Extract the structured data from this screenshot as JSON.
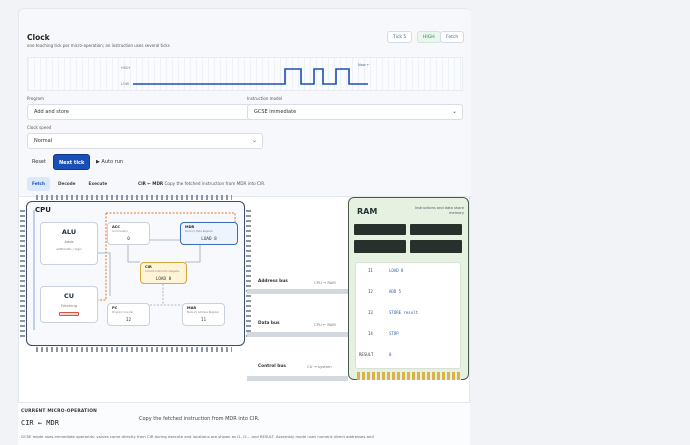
{
  "clock": {
    "title": "Clock",
    "subtitle": "one teaching tick per micro-operation; an instruction uses several ticks",
    "tick_label": "Tick 5",
    "level_label": "HIGH",
    "phase_label": "Fetch",
    "wave_high": "HIGH",
    "wave_low": "LOW",
    "wave_now": "Now ←"
  },
  "controls": {
    "program_label": "Program",
    "program_value": "Add and store",
    "model_label": "Instruction model",
    "model_value": "GCSE immediate",
    "speed_label": "Clock speed",
    "speed_value": "Normal",
    "reset": "Reset",
    "next_tick": "Next tick",
    "auto_run": "▶  Auto run"
  },
  "steps": {
    "items": [
      "Fetch",
      "Decode",
      "Execute"
    ],
    "active": "Fetch",
    "current_op": "CIR ← MDR",
    "current_desc": "Copy the fetched instruction from MDR into CIR."
  },
  "cpu": {
    "label": "CPU",
    "alu": {
      "title": "ALU",
      "sub": "Adds",
      "sub2": "arithmetic / logic"
    },
    "cu": {
      "title": "CU",
      "sub": "Fetching"
    },
    "acc": {
      "title": "ACC",
      "sub": "Accumulator",
      "value": "0"
    },
    "mdr": {
      "title": "MDR",
      "sub": "Memory Data Register",
      "value": "LOAD 8"
    },
    "cir": {
      "title": "CIR",
      "sub": "Current Instruction Register",
      "value": "LOAD 8"
    },
    "pc": {
      "title": "PC",
      "sub": "Program Counter",
      "value": "I2"
    },
    "mar": {
      "title": "MAR",
      "sub": "Memory Address Register",
      "value": "I1"
    }
  },
  "buses": {
    "address": "Address bus",
    "address_dir": "CPU → RAM",
    "data": "Data bus",
    "data_dir": "CPU ← RAM",
    "control": "Control bus",
    "control_dir": "CU → system"
  },
  "ram": {
    "title": "RAM",
    "subtitle": "Instructions and data share memory",
    "rows": [
      {
        "addr": "I1",
        "value": "LOAD 8"
      },
      {
        "addr": "I2",
        "value": "ADD 5"
      },
      {
        "addr": "I3",
        "value": "STORE result"
      },
      {
        "addr": "I4",
        "value": "STOP"
      },
      {
        "addr": "RESULT",
        "value": "0"
      }
    ]
  },
  "current": {
    "label": "CURRENT MICRO-OPERATION",
    "op": "CIR ← MDR",
    "desc": "Copy the fetched instruction from MDR into CIR.",
    "note": "GCSE mode uses immediate operands: values come directly from CIR during execute and locations are shown as I1, I2... and RESULT. Assembly mode uses numeric direct addresses and"
  }
}
